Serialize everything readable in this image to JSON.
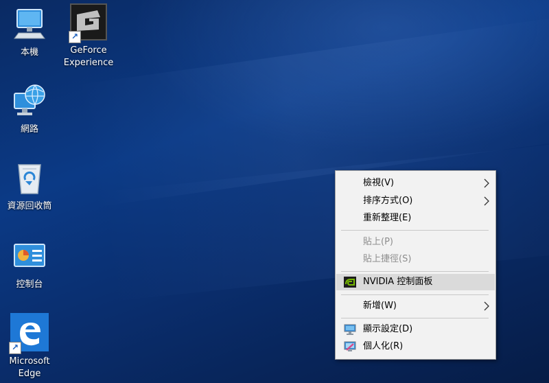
{
  "desktop": {
    "icons": [
      {
        "label": "本機",
        "icon": "this-pc-icon"
      },
      {
        "label": "GeForce Experience",
        "icon": "geforce-experience-icon"
      },
      {
        "label": "網路",
        "icon": "network-icon"
      },
      {
        "label": "資源回收筒",
        "icon": "recycle-bin-icon"
      },
      {
        "label": "控制台",
        "icon": "control-panel-icon"
      },
      {
        "label": "Microsoft Edge",
        "icon": "edge-icon"
      }
    ]
  },
  "context_menu": {
    "items": [
      {
        "label": "檢視(V)",
        "submenu": true,
        "enabled": true
      },
      {
        "label": "排序方式(O)",
        "submenu": true,
        "enabled": true
      },
      {
        "label": "重新整理(E)",
        "submenu": false,
        "enabled": true
      },
      {
        "label": "貼上(P)",
        "submenu": false,
        "enabled": false
      },
      {
        "label": "貼上捷徑(S)",
        "submenu": false,
        "enabled": false
      },
      {
        "label": "NVIDIA 控制面板",
        "submenu": false,
        "enabled": true,
        "icon": "nvidia-icon",
        "highlighted": true
      },
      {
        "label": "新增(W)",
        "submenu": true,
        "enabled": true
      },
      {
        "label": "顯示設定(D)",
        "submenu": false,
        "enabled": true,
        "icon": "display-settings-icon"
      },
      {
        "label": "個人化(R)",
        "submenu": false,
        "enabled": true,
        "icon": "personalize-icon"
      }
    ]
  },
  "colors": {
    "desktop_background": "#0b3a86",
    "menu_background": "#f2f2f2",
    "menu_highlight": "#dadada",
    "disabled_text": "#8d8d8d"
  }
}
